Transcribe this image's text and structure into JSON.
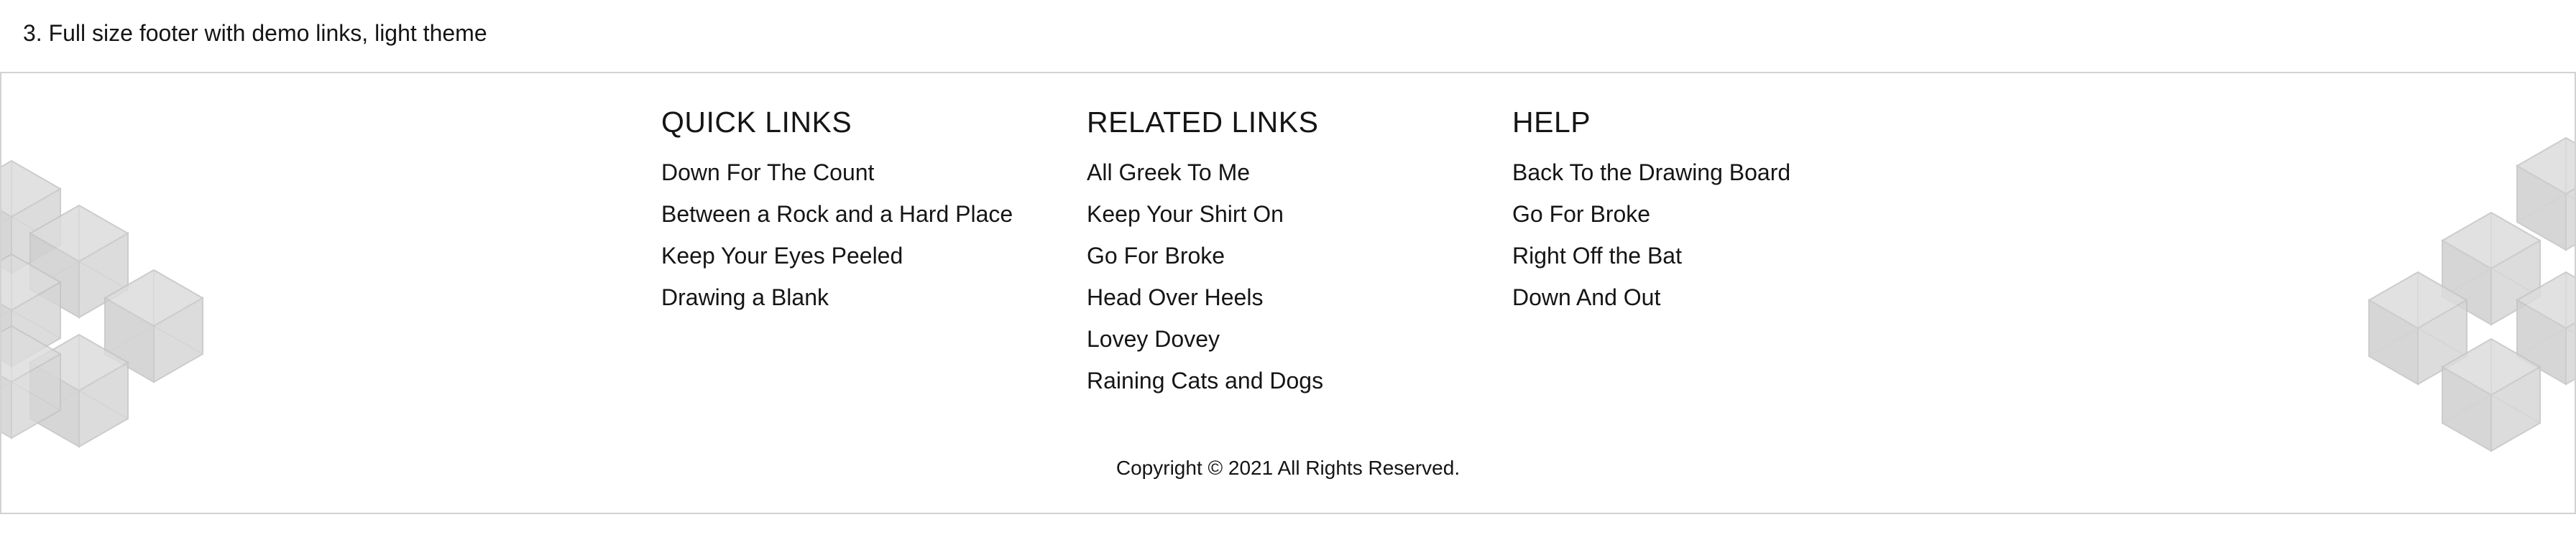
{
  "demo": {
    "title": "3. Full size footer with demo links, light theme"
  },
  "footer": {
    "columns": [
      {
        "heading": "QUICK LINKS",
        "links": [
          "Down For The Count",
          "Between a Rock and a Hard Place",
          "Keep Your Eyes Peeled",
          "Drawing a Blank"
        ]
      },
      {
        "heading": "RELATED LINKS",
        "links": [
          "All Greek To Me",
          "Keep Your Shirt On",
          "Go For Broke",
          "Head Over Heels",
          "Lovey Dovey",
          "Raining Cats and Dogs"
        ]
      },
      {
        "heading": "HELP",
        "links": [
          "Back To the Drawing Board",
          "Go For Broke",
          "Right Off the Bat",
          "Down And Out"
        ]
      }
    ],
    "copyright": "Copyright © 2021 All Rights Reserved.",
    "decoration": {
      "left": "cube-pattern-icon",
      "right": "cube-pattern-icon"
    }
  },
  "colors": {
    "text": "#151515",
    "border": "#d2d2d2",
    "cube_fill": "#d6d6d6",
    "cube_stroke": "#c4c4c4"
  }
}
